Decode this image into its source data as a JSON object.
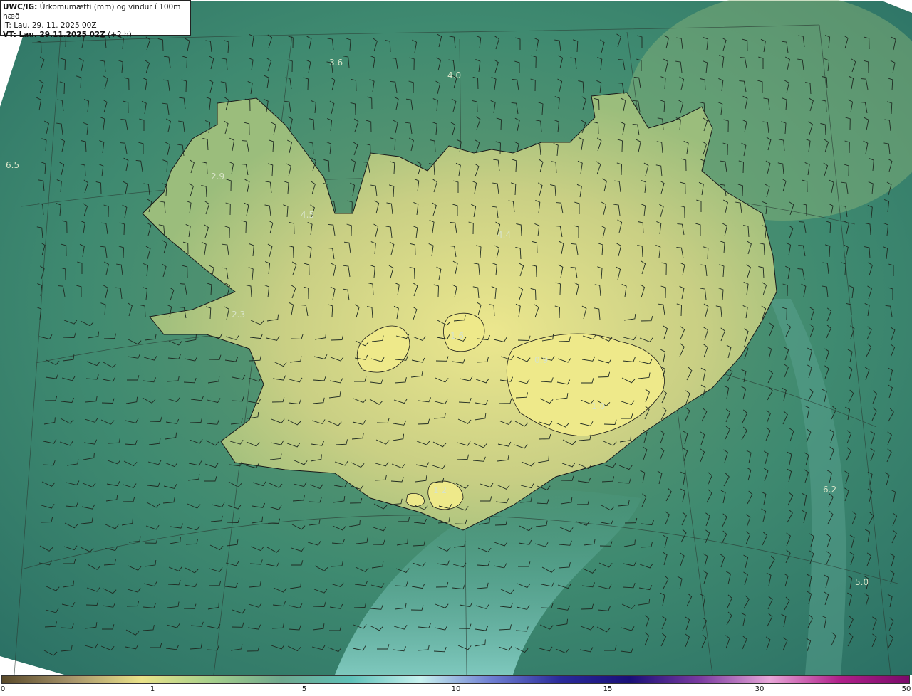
{
  "info": {
    "model": "UWC/IG:",
    "title": "Úrkomumætti (mm) og vindur í 100m hæð",
    "it": "IT: Lau. 29. 11. 2025 00Z",
    "vt_label": "VT: Lau. 29.11.2025 02Z",
    "vt_suffix": "(+2 h)"
  },
  "colors": {
    "sea_dark": "#2f7a6a",
    "land_light": "#e8e48c",
    "channel": "#7fc6bc",
    "coast": "#1a1a1a",
    "barb": "#1f2a22"
  },
  "value_labels": [
    {
      "text": "3.6"
    },
    {
      "text": "4.0"
    },
    {
      "text": "6.5"
    },
    {
      "text": "2.9"
    },
    {
      "text": "4.5"
    },
    {
      "text": "4.4"
    },
    {
      "text": "2.3"
    },
    {
      "text": "1.6"
    },
    {
      "text": "0.9"
    },
    {
      "text": "1.0"
    },
    {
      "text": "1.2"
    },
    {
      "text": "6.2"
    },
    {
      "text": "5.0"
    }
  ],
  "colorbar": {
    "ticks": [
      {
        "label": "0",
        "value": 0
      },
      {
        "label": "1",
        "value": 1
      },
      {
        "label": "5",
        "value": 5
      },
      {
        "label": "10",
        "value": 10
      },
      {
        "label": "15",
        "value": 15
      },
      {
        "label": "30",
        "value": 30
      },
      {
        "label": "50",
        "value": 50
      }
    ],
    "stops": [
      "#5a4a2a",
      "#a7946a",
      "#eae389",
      "#a6cf8b",
      "#6fa88e",
      "#5fc0b8",
      "#c8f2ef",
      "#6f7fd3",
      "#2a2a9a",
      "#1a1078",
      "#7a3aa0",
      "#e8a6d8",
      "#b0208a",
      "#7a0a6a"
    ]
  }
}
